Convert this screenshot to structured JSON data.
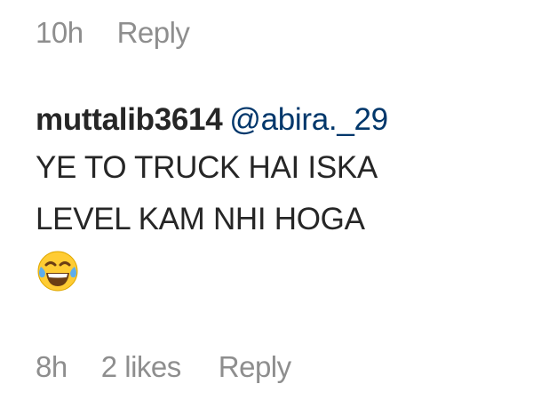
{
  "previous_comment": {
    "time": "10h",
    "reply_label": "Reply"
  },
  "comment": {
    "username": "muttalib3614",
    "mention": "@abira._29",
    "text_line1": "YE TO TRUCK HAI ISKA",
    "text_line2": "LEVEL KAM NHI HOGA",
    "emoji_icon": "face-with-tears-of-joy-icon",
    "time": "8h",
    "likes": "2 likes",
    "reply_label": "Reply"
  },
  "colors": {
    "text": "#262626",
    "meta": "#8e8e8e",
    "mention": "#00376b",
    "emoji_face": "#ffcc33",
    "emoji_tears": "#5dadec"
  }
}
